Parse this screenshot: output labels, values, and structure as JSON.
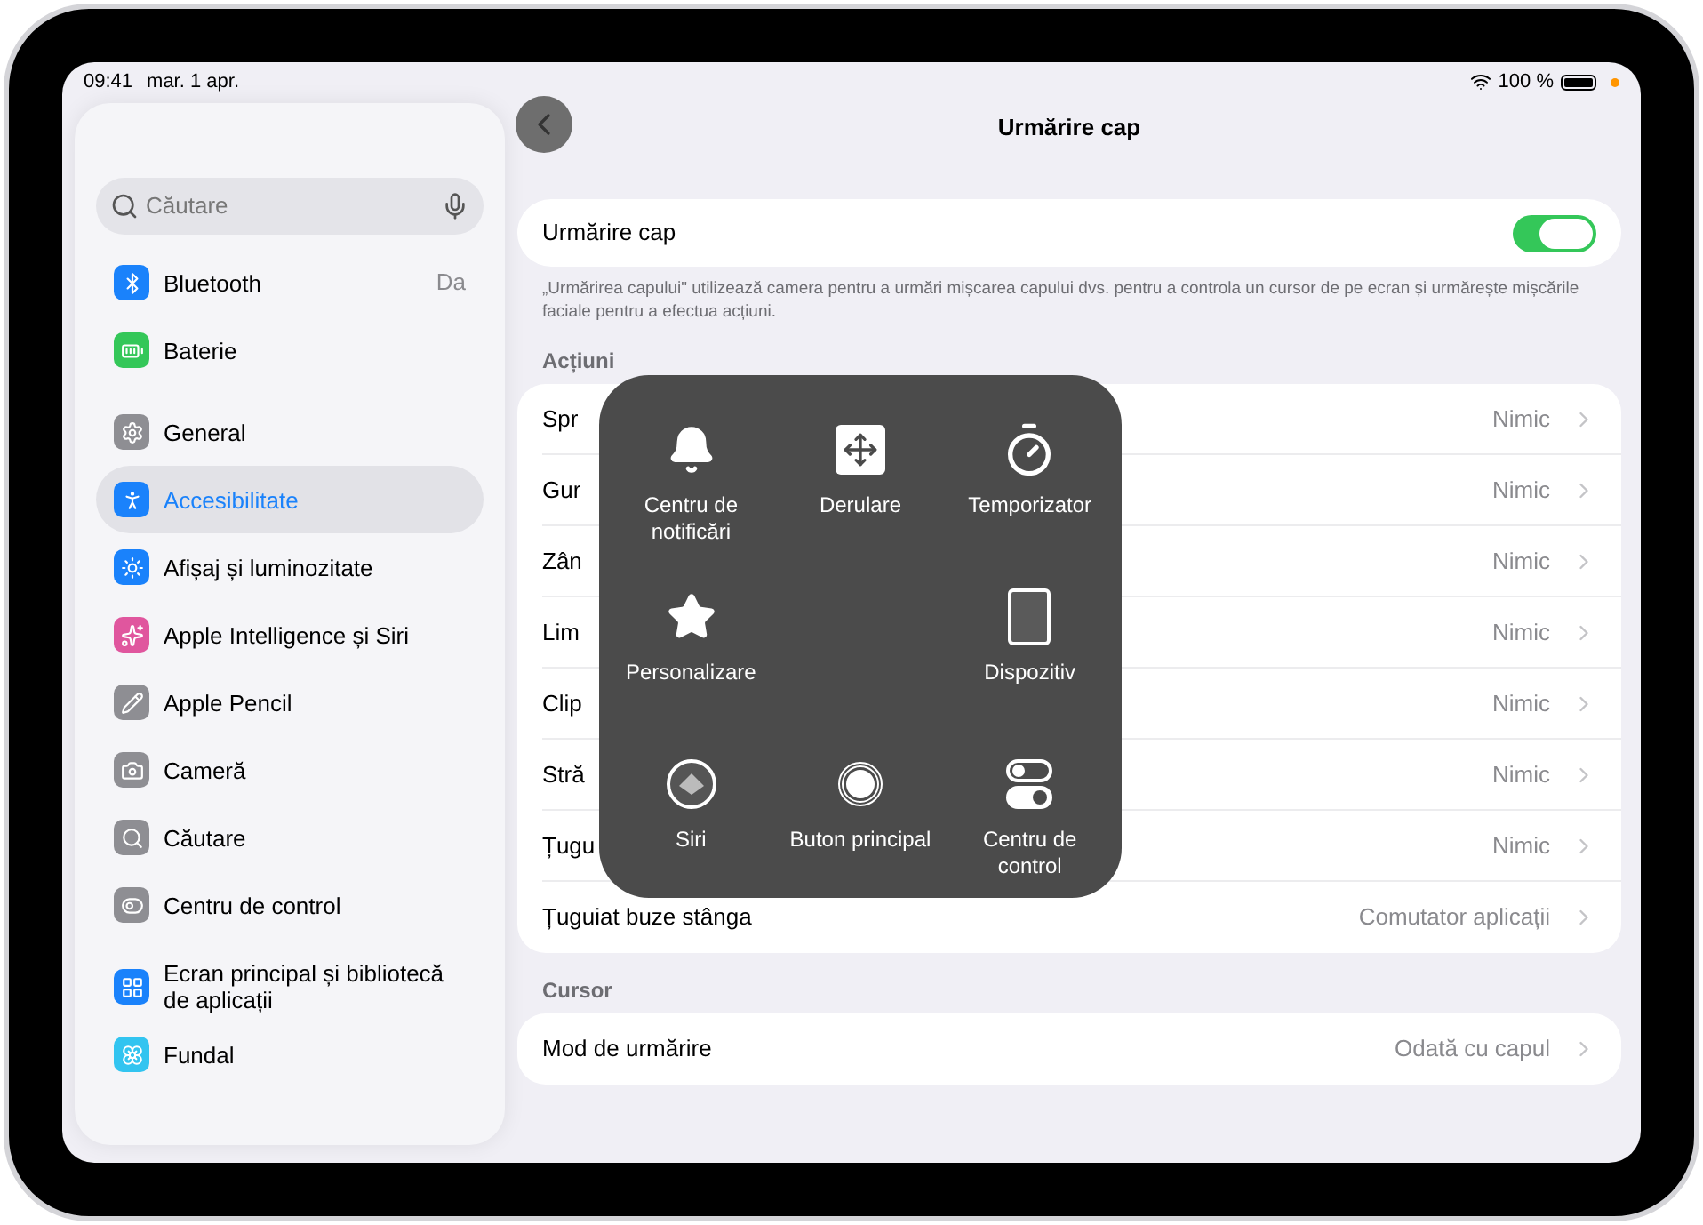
{
  "status_bar": {
    "time": "09:41",
    "date": "mar. 1 apr.",
    "battery": "100 %"
  },
  "sidebar": {
    "search": {
      "placeholder": "Căutare"
    },
    "groups": [
      [
        {
          "kind": "bluetooth",
          "label": "Bluetooth",
          "value": "Da",
          "color": "#1a82fb",
          "selected": false
        },
        {
          "kind": "battery",
          "label": "Baterie",
          "color": "#34c759",
          "selected": false
        }
      ],
      [
        {
          "kind": "gear",
          "label": "General",
          "color": "#8e8e93",
          "selected": false
        },
        {
          "kind": "accessibility",
          "label": "Accesibilitate",
          "color": "#1a82fb",
          "selected": true
        },
        {
          "kind": "sun",
          "label": "Afișaj și luminozitate",
          "color": "#1a82fb",
          "selected": false
        },
        {
          "kind": "intelligence",
          "label": "Apple Intelligence și Siri",
          "color": "#e0569e",
          "selected": false
        },
        {
          "kind": "pencil",
          "label": "Apple Pencil",
          "color": "#8e8e93",
          "selected": false
        },
        {
          "kind": "camera",
          "label": "Cameră",
          "color": "#8e8e93",
          "selected": false
        },
        {
          "kind": "search",
          "label": "Căutare",
          "color": "#8e8e93",
          "selected": false
        },
        {
          "kind": "toggles",
          "label": "Centru de control",
          "color": "#8e8e93",
          "selected": false
        }
      ],
      [
        {
          "kind": "homescreen",
          "label": "Ecran principal și bibliotecă de aplicații",
          "color": "#1a82fb",
          "selected": false
        },
        {
          "kind": "flower",
          "label": "Fundal",
          "color": "#32c4f0",
          "selected": false
        }
      ]
    ]
  },
  "main": {
    "title": "Urmărire cap",
    "toggle": {
      "label": "Urmărire cap",
      "on": true
    },
    "description": "„Urmărirea capului\" utilizează camera pentru a urmări mișcarea capului dvs. pentru a controla un cursor de pe ecran și urmărește mișcările faciale pentru a efectua acțiuni.",
    "sections": [
      {
        "title": "Acțiuni",
        "rows": [
          {
            "label": "Spr",
            "value": "Nimic"
          },
          {
            "label": "Gur",
            "value": "Nimic"
          },
          {
            "label": "Zân",
            "value": "Nimic"
          },
          {
            "label": "Lim",
            "value": "Nimic"
          },
          {
            "label": "Clip",
            "value": "Nimic"
          },
          {
            "label": "Stră",
            "value": "Nimic"
          },
          {
            "label": "Țugu",
            "value": "Nimic"
          },
          {
            "label": "Țuguiat buze stânga",
            "value": "Comutator aplicații"
          }
        ]
      },
      {
        "title": "Cursor",
        "rows": [
          {
            "label": "Mod de urmărire",
            "value": "Odată cu capul"
          }
        ]
      }
    ]
  },
  "popup": {
    "rows": [
      [
        {
          "kind": "bell",
          "label": "Centru de notificări"
        },
        {
          "kind": "scroll",
          "label": "Derulare"
        },
        {
          "kind": "timer",
          "label": "Temporizator"
        }
      ],
      [
        {
          "kind": "star",
          "label": "Personalizare"
        },
        null,
        {
          "kind": "device",
          "label": "Dispozitiv"
        }
      ],
      [
        {
          "kind": "siri",
          "label": "Siri"
        },
        {
          "kind": "home",
          "label": "Buton principal"
        },
        {
          "kind": "controls",
          "label": "Centru de control"
        }
      ]
    ]
  }
}
